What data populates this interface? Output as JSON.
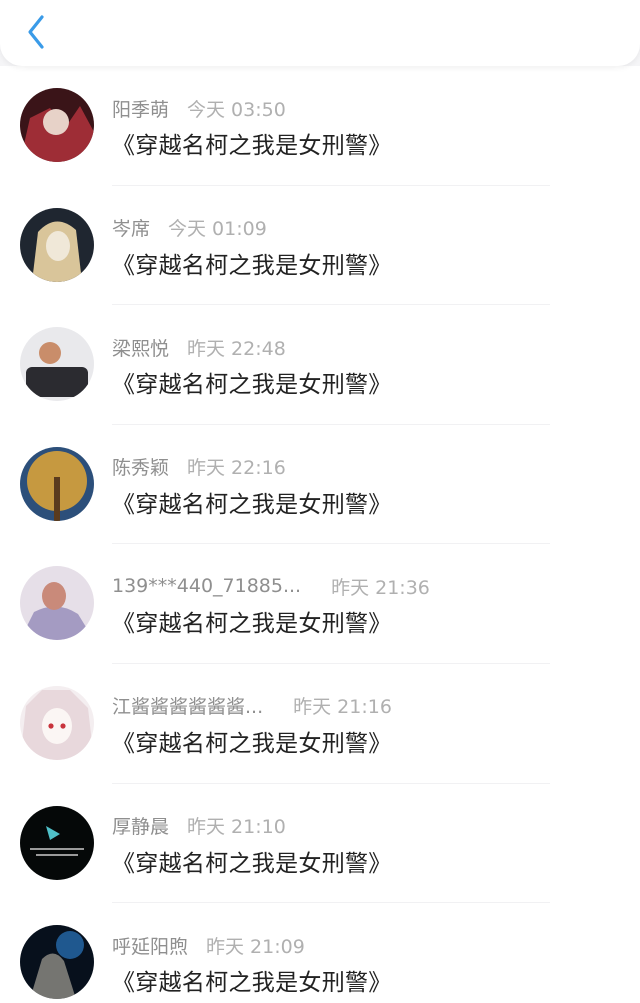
{
  "header": {
    "back_icon": "chevron-left-icon",
    "accent": "#3a9be8"
  },
  "comments": [
    {
      "name": "阳季萌",
      "time": "今天 03:50",
      "text": "《穿越名柯之我是女刑警》",
      "avatar_colors": [
        "#3a1418",
        "#b0313c",
        "#e7d2c8"
      ]
    },
    {
      "name": "岑席",
      "time": "今天 01:09",
      "text": "《穿越名柯之我是女刑警》",
      "avatar_colors": [
        "#1f2630",
        "#d9c59a",
        "#f0e8d8"
      ]
    },
    {
      "name": "梁熙悦",
      "time": "昨天 22:48",
      "text": "《穿越名柯之我是女刑警》",
      "avatar_colors": [
        "#e9e9ec",
        "#2b2b30",
        "#c98d6a"
      ]
    },
    {
      "name": "陈秀颖",
      "time": "昨天 22:16",
      "text": "《穿越名柯之我是女刑警》",
      "avatar_colors": [
        "#2c4f7a",
        "#d7a13a",
        "#5a3b1e"
      ]
    },
    {
      "name": "139***440_71885...",
      "time": "昨天 21:36",
      "text": "《穿越名柯之我是女刑警》",
      "avatar_colors": [
        "#e6dfe8",
        "#a49bc2",
        "#c98a7a"
      ]
    },
    {
      "name": "江酱酱酱酱酱酱...",
      "time": "昨天 21:16",
      "text": "《穿越名柯之我是女刑警》",
      "avatar_colors": [
        "#f4eef0",
        "#c8333c",
        "#e8d8dc"
      ]
    },
    {
      "name": "厚静晨",
      "time": "昨天 21:10",
      "text": "《穿越名柯之我是女刑警》",
      "avatar_colors": [
        "#050808",
        "#4fc0c8",
        "#9a9a9a"
      ]
    },
    {
      "name": "呼延阳煦",
      "time": "昨天 21:09",
      "text": "《穿越名柯之我是女刑警》",
      "avatar_colors": [
        "#07101c",
        "#2a78c0",
        "#d0c8b8"
      ]
    }
  ]
}
